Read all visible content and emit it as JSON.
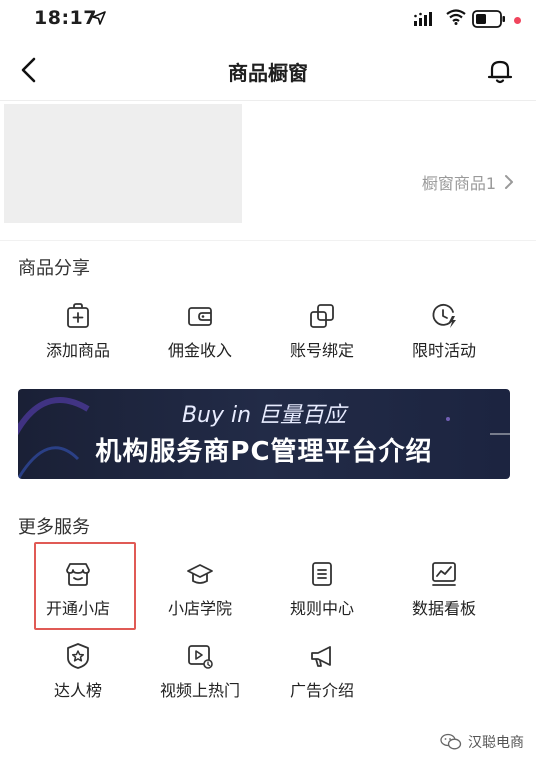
{
  "status_bar": {
    "time": "18:17"
  },
  "nav": {
    "title": "商品橱窗"
  },
  "showcase": {
    "link_label": "橱窗商品1"
  },
  "product_share": {
    "title": "商品分享",
    "items": [
      {
        "label": "添加商品",
        "icon": "add-product-icon"
      },
      {
        "label": "佣金收入",
        "icon": "wallet-icon"
      },
      {
        "label": "账号绑定",
        "icon": "link-icon"
      },
      {
        "label": "限时活动",
        "icon": "clock-icon"
      }
    ]
  },
  "banner": {
    "subtitle": "Buy in 巨量百应",
    "title": "机构服务商PC管理平台介绍"
  },
  "more_services": {
    "title": "更多服务",
    "items": [
      {
        "label": "开通小店",
        "icon": "store-icon"
      },
      {
        "label": "小店学院",
        "icon": "graduation-cap-icon"
      },
      {
        "label": "规则中心",
        "icon": "document-icon"
      },
      {
        "label": "数据看板",
        "icon": "chart-icon"
      },
      {
        "label": "达人榜",
        "icon": "badge-star-icon"
      },
      {
        "label": "视频上热门",
        "icon": "video-icon"
      },
      {
        "label": "广告介绍",
        "icon": "megaphone-icon"
      }
    ]
  },
  "watermark": {
    "text": "汉聪电商"
  },
  "colors": {
    "highlight": "#e05a55",
    "notification_dot": "#f0455d",
    "banner_bg": "#1f2742"
  }
}
